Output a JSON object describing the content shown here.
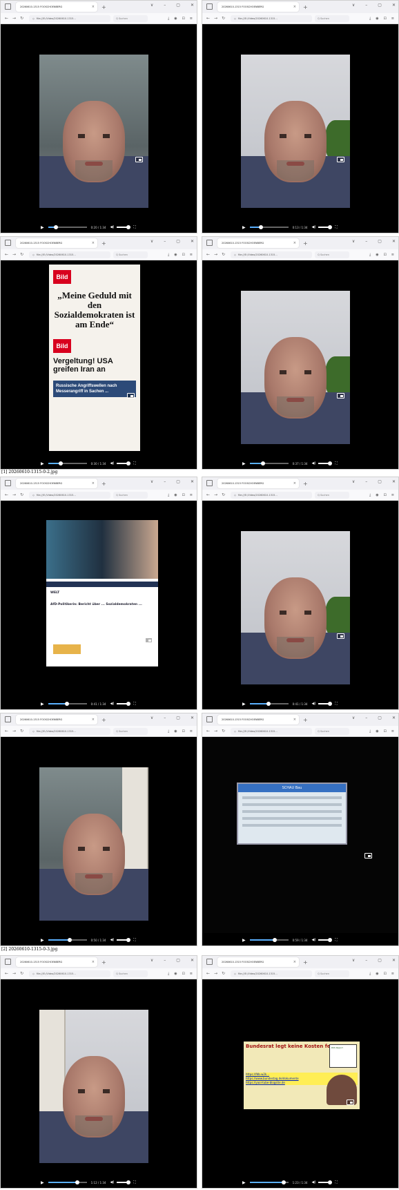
{
  "captions": [
    "[1] 20260610-1315-0-2.jpg",
    "[2] 20260610-1315-0-3.jpg"
  ],
  "browser": {
    "tab_title": "20260610-1315 FOOSCHOENBERG ×",
    "tab_title_short": "20260610-1315 FOOSCHOENBERG",
    "url_text": "file:///E:/Video/20260610-1315...",
    "search_placeholder": "Q Suchen",
    "new_tab": "+"
  },
  "windows": [
    {
      "time": "0:20 / 1:34",
      "progress": 0.21
    },
    {
      "time": "0:13 / 1:34",
      "progress": 0.3
    },
    {
      "time": "0:30 / 1:34",
      "progress": 0.33
    },
    {
      "time": "0:37 / 1:34",
      "progress": 0.35
    },
    {
      "time": "0:41 / 1:34",
      "progress": 0.48
    },
    {
      "time": "0:41 / 1:34",
      "progress": 0.48
    },
    {
      "time": "0:50 / 1:34",
      "progress": 0.56
    },
    {
      "time": "0:59 / 1:34",
      "progress": 0.65
    },
    {
      "time": "1:12 / 1:34",
      "progress": 0.75
    },
    {
      "time": "1:23 / 1:34",
      "progress": 0.88
    }
  ],
  "news1": {
    "logo": "Bild",
    "headline": "„Meine Geduld mit den Sozialdemokraten ist am Ende“",
    "headline2": "Vergeltung! USA greifen Iran an",
    "banner": "Russische Angriffswellen nach Messerangriff in Sachen ..."
  },
  "news2": {
    "site": "WELT",
    "text": "AfD-Politikerin: Bericht über ... Sozialdemokraten ..."
  },
  "screen": {
    "header": "SCHAU Bau"
  },
  "collage": {
    "title": "Bundesrat legt keine Kosten fest",
    "link1": "https://fdb.w2k...",
    "link2": "https://www.bundestag.de/dokumente",
    "link3": "https://yaoi-tube-blogsite.de",
    "ad": "RSS Report"
  }
}
